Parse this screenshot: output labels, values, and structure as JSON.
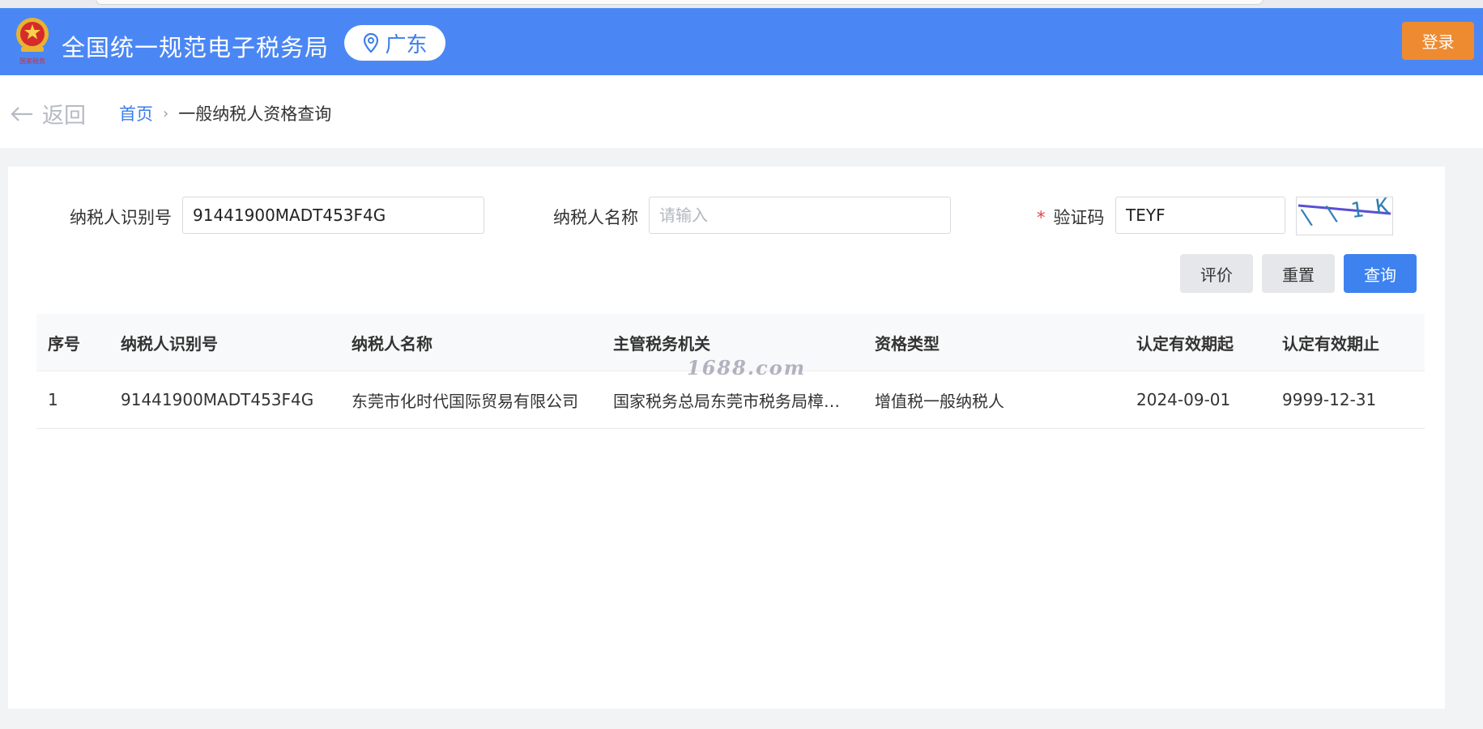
{
  "header": {
    "site_title": "全国统一规范电子税务局",
    "region": "广东",
    "login_label": "登录",
    "emblem_text": "国家税务"
  },
  "subnav": {
    "back_label": "返回",
    "breadcrumb": {
      "home": "首页",
      "separator": "›",
      "current": "一般纳税人资格查询"
    }
  },
  "form": {
    "taxpayer_id": {
      "label": "纳税人识别号",
      "value": "91441900MADT453F4G"
    },
    "taxpayer_name": {
      "label": "纳税人名称",
      "placeholder": "请输入",
      "value": ""
    },
    "captcha": {
      "required_mark": "*",
      "label": "验证码",
      "value": "TEYF",
      "image_text": "\\ \\ 1 K"
    },
    "buttons": {
      "evaluate": "评价",
      "reset": "重置",
      "query": "查询"
    }
  },
  "table": {
    "columns": [
      "序号",
      "纳税人识别号",
      "纳税人名称",
      "主管税务机关",
      "资格类型",
      "认定有效期起",
      "认定有效期止"
    ],
    "rows": [
      [
        "1",
        "91441900MADT453F4G",
        "东莞市化时代国际贸易有限公司",
        "国家税务总局东莞市税务局樟木头税务分局",
        "增值税一般纳税人",
        "2024-09-01",
        "9999-12-31"
      ]
    ]
  },
  "watermark": "1688.com",
  "colors": {
    "header": "#4b87f4",
    "login": "#ee8a2f",
    "primary": "#3d82ef",
    "link": "#3d7ee9"
  }
}
